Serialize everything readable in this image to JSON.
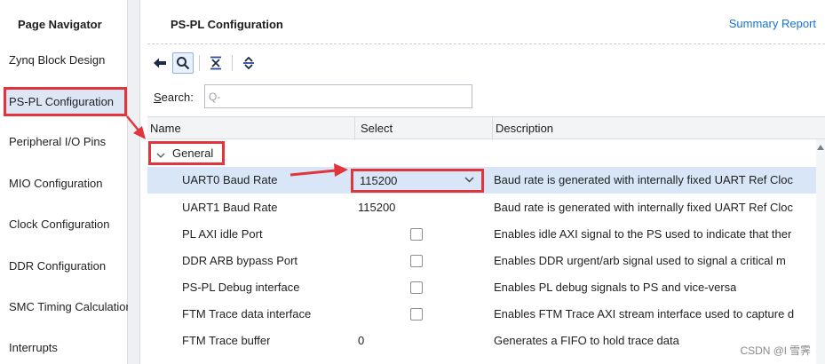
{
  "navigator": {
    "title": "Page Navigator",
    "items": [
      {
        "label": "Zynq Block Design"
      },
      {
        "label": "PS-PL Configuration"
      },
      {
        "label": "Peripheral I/O Pins"
      },
      {
        "label": "MIO Configuration"
      },
      {
        "label": "Clock Configuration"
      },
      {
        "label": "DDR Configuration"
      },
      {
        "label": "SMC Timing Calculation"
      },
      {
        "label": "Interrupts"
      }
    ],
    "selected_index": 1
  },
  "main": {
    "title": "PS-PL Configuration",
    "summary_link": "Summary Report",
    "toolbar_icons": [
      "back-arrow-icon",
      "search-icon",
      "collapse-all-icon",
      "expand-all-icon"
    ],
    "search": {
      "label_prefix": "S",
      "label_rest": "earch:",
      "placeholder": "Q-",
      "value": ""
    }
  },
  "table": {
    "columns": [
      "Name",
      "Select",
      "Description"
    ],
    "group": {
      "label": "General",
      "expanded": true
    },
    "rows": [
      {
        "name": "UART0 Baud Rate",
        "type": "dropdown",
        "value": "115200",
        "description": "Baud rate is generated with internally fixed UART Ref Cloc",
        "selected": true
      },
      {
        "name": "UART1 Baud Rate",
        "type": "text",
        "value": "115200",
        "description": "Baud rate is generated with internally fixed UART Ref Cloc"
      },
      {
        "name": "PL AXI idle Port",
        "type": "checkbox",
        "checked": false,
        "description": "Enables idle AXI signal to the PS used to indicate that ther"
      },
      {
        "name": "DDR ARB bypass Port",
        "type": "checkbox",
        "checked": false,
        "description": "Enables DDR urgent/arb signal used to signal a critical m"
      },
      {
        "name": "PS-PL Debug interface",
        "type": "checkbox",
        "checked": false,
        "description": "Enables PL debug signals to PS and vice-versa"
      },
      {
        "name": "FTM Trace data interface",
        "type": "checkbox",
        "checked": false,
        "description": "Enables FTM Trace AXI stream interface used to capture d"
      },
      {
        "name": "FTM Trace buffer",
        "type": "text",
        "value": "0",
        "description": "Generates a FIFO to hold trace data"
      }
    ]
  },
  "watermark": "CSDN @l 雪霁",
  "colors": {
    "highlight_red": "#e2353b",
    "link_blue": "#1874d0",
    "selection_blue": "#d8e6f8"
  }
}
